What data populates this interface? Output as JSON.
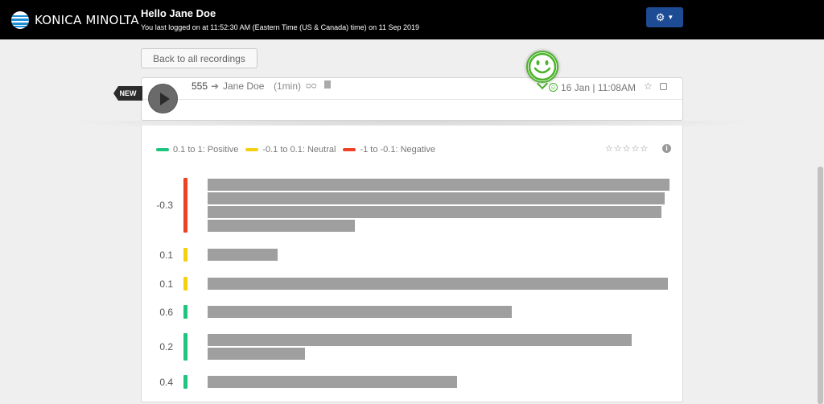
{
  "header": {
    "logo_text": "KONICA MINOLTA",
    "greeting": "Hello Jane Doe",
    "last_logon": "You last logged on at 11:52:30 AM (Eastern Time (US & Canada) time) on 11 Sep 2019",
    "settings_icon": "gear-icon",
    "settings_glyph": "⚙",
    "caret_glyph": "▼"
  },
  "back_button": "Back to all recordings",
  "recording": {
    "badge": "NEW",
    "from": "555",
    "arrow": "➜",
    "to": "Jane Doe",
    "duration": "(1min)",
    "voicemail_glyph": "ᴑᴑ",
    "date": "16 Jan | 11:08AM",
    "star_glyph": "☆",
    "sentiment": "positive",
    "sentiment_glyph": "☺"
  },
  "legend": [
    {
      "label": "0.1 to 1: Positive",
      "color": "#1ec57e"
    },
    {
      "label": "-0.1 to 0.1: Neutral",
      "color": "#f5cf12"
    },
    {
      "label": "-1 to -0.1: Negative",
      "color": "#ef4123"
    }
  ],
  "rating_stars": "☆☆☆☆☆",
  "info_glyph": "i",
  "segments": [
    {
      "score": "-0.3",
      "sentiment": "negative",
      "line_fractions": [
        1.0,
        0.99,
        0.983,
        0.318
      ]
    },
    {
      "score": "0.1",
      "sentiment": "neutral",
      "line_fractions": [
        0.152
      ]
    },
    {
      "score": "0.1",
      "sentiment": "neutral",
      "line_fractions": [
        0.997
      ]
    },
    {
      "score": "0.6",
      "sentiment": "positive",
      "line_fractions": [
        0.659
      ]
    },
    {
      "score": "0.2",
      "sentiment": "positive",
      "line_fractions": [
        0.918,
        0.21
      ]
    },
    {
      "score": "0.4",
      "sentiment": "positive",
      "line_fractions": [
        0.54
      ]
    }
  ]
}
